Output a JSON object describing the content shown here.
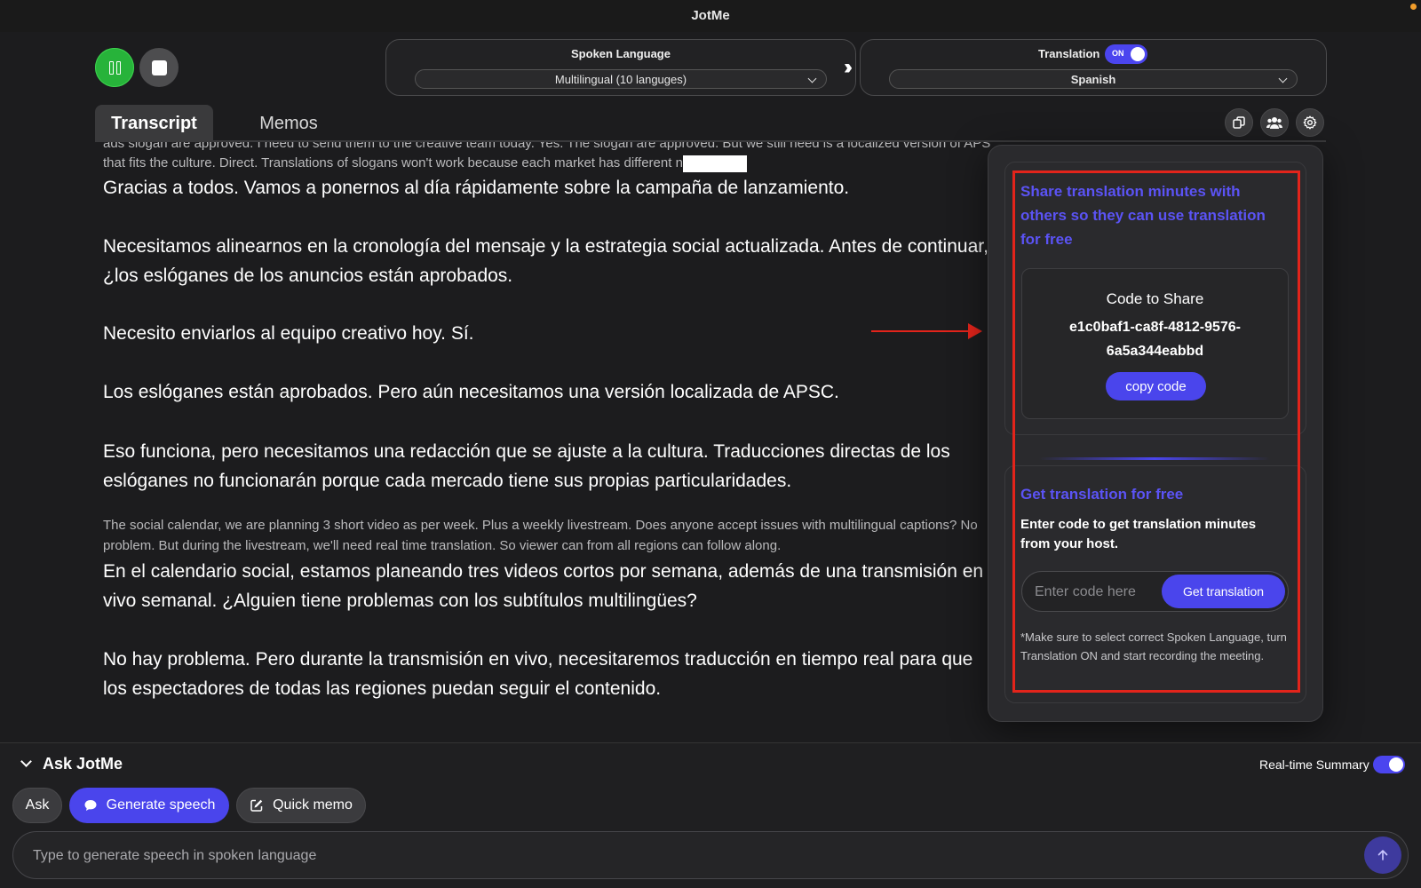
{
  "app": {
    "title": "JotMe"
  },
  "spoken": {
    "label": "Spoken Language",
    "selected": "Multilingual (10 languges)"
  },
  "translation": {
    "label": "Translation",
    "toggle": "ON",
    "selected": "Spanish"
  },
  "tabs": [
    {
      "label": "Transcript"
    },
    {
      "label": "Memos"
    }
  ],
  "transcript": {
    "cut_line": "ads slogan are approved. I need to send them to the creative team today. Yes. The slogan are approved. But we still need is a localized version of APSC. That works, but we need phrasing",
    "original_1": "that fits the culture. Direct. Translations of slogans won't work because each market has different",
    "tail_char": "n",
    "lines": [
      "Gracias a todos. Vamos a ponernos al día rápidamente sobre la campaña de lanzamiento.",
      "Necesitamos alinearnos en la cronología del mensaje y la estrategia social actualizada. Antes de continuar, ¿los eslóganes de los anuncios están aprobados.",
      "Necesito enviarlos al equipo creativo hoy. Sí.",
      "Los eslóganes están aprobados. Pero aún necesitamos una versión localizada de APSC.",
      "Eso funciona, pero necesitamos una redacción que se ajuste a la cultura. Traducciones directas de los eslóganes no funcionarán porque cada mercado tiene sus propias particularidades."
    ],
    "original_2": "The social calendar, we are planning 3 short video as per week. Plus a weekly livestream. Does anyone accept issues with multilingual captions? No problem. But during the livestream, we'll need real time translation. So viewer can from all regions can follow along.",
    "lines_2": [
      "En el calendario social, estamos planeando tres videos cortos por semana, además de una transmisión en vivo semanal. ¿Alguien tiene problemas con los subtítulos multilingües?",
      "No hay problema. Pero durante la transmisión en vivo, necesitaremos traducción en tiempo real para que los espectadores de todas las regiones puedan seguir el contenido."
    ]
  },
  "share_panel": {
    "heading": "Share translation minutes with others so they can use translation for free",
    "code_title": "Code to Share",
    "code_value": "e1c0baf1-ca8f-4812-9576-6a5a344eabbd",
    "copy_label": "copy code",
    "get_heading": "Get translation for free",
    "get_desc": "Enter code to get translation minutes from your host.",
    "input_placeholder": "Enter code here",
    "get_button": "Get translation",
    "note": "*Make sure to select correct Spoken Language, turn Translation ON and start recording the meeting."
  },
  "ask": {
    "title": "Ask JotMe",
    "realtime_label": "Real-time Summary",
    "chips": [
      "Ask",
      "Generate speech",
      "Quick memo"
    ],
    "input_placeholder": "Type to generate speech in spoken language"
  },
  "colors": {
    "accent": "#4a45ec",
    "heading": "#5b53f5",
    "highlight": "#e3241b",
    "record": "#27b33a"
  }
}
